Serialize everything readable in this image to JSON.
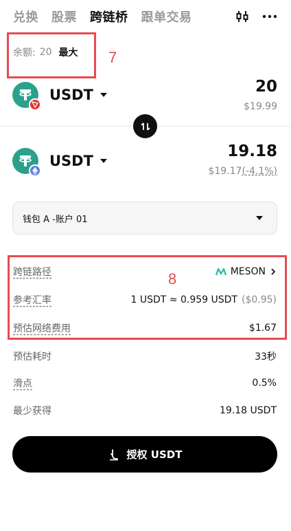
{
  "tabs": [
    "兑换",
    "股票",
    "跨链桥",
    "跟单交易"
  ],
  "active_tab": "跨链桥",
  "balance": {
    "label": "余额:",
    "value": "20",
    "max": "最大"
  },
  "annotations": {
    "box7": "7",
    "box8": "8"
  },
  "from": {
    "token": "USDT",
    "amount": "20",
    "usd": "$19.99",
    "chain_badge": "tron-icon"
  },
  "to": {
    "token": "USDT",
    "amount": "19.18",
    "usd": "$19.17",
    "pct": "(-4.1%)",
    "chain_badge": "ethereum-icon"
  },
  "wallet": {
    "label": "钱包 A -账户 01"
  },
  "rows": {
    "route": {
      "label": "跨链路径",
      "value": "MESON"
    },
    "rate": {
      "label": "参考汇率",
      "value": "1 USDT ≈ 0.959 USDT",
      "usd": "($0.95)"
    },
    "fee": {
      "label": "预估网络费用",
      "value": "$1.67"
    },
    "time": {
      "label": "预估耗时",
      "value": "33秒"
    },
    "slippage": {
      "label": "滑点",
      "value": "0.5%"
    },
    "min": {
      "label": "最少获得",
      "value": "19.18 USDT"
    }
  },
  "cta": {
    "label": "授权 USDT"
  },
  "colors": {
    "annotation": "#e84a50",
    "tether": "#2ba18d",
    "tron": "#e3342f",
    "eth": "#627eea"
  }
}
